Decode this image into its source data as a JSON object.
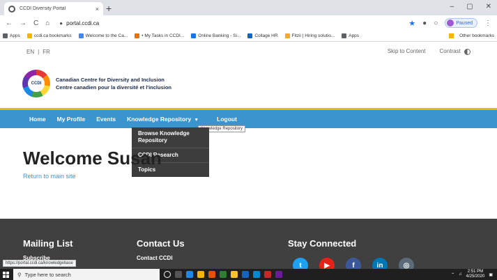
{
  "browser": {
    "tab_title": "CCDI Diversity Portal",
    "tab_close": "×",
    "new_tab": "+",
    "window_controls": [
      "–",
      "▢",
      "✕"
    ],
    "nav_buttons": [
      "←",
      "→",
      "C",
      "⌂"
    ],
    "url": "portal.ccdi.ca",
    "profile_status": "Paused",
    "menu_icon": "⋮",
    "bookmarks": [
      {
        "label": "Apps",
        "color": "#5f6368"
      },
      {
        "label": "ccdi.ca bookmarks",
        "color": "#f4b400"
      },
      {
        "label": "Welcome to the Ca...",
        "color": "#4285f4"
      },
      {
        "label": "• My Tasks in CCDI...",
        "color": "#e8710a"
      },
      {
        "label": "Online Banking - Si...",
        "color": "#1a73e8"
      },
      {
        "label": "Collage HR",
        "color": "#1565c0"
      },
      {
        "label": "Fitzii | Hiring solutio...",
        "color": "#f9a825"
      },
      {
        "label": "Apps",
        "color": "#5f6368"
      }
    ],
    "other_bookmarks": "Other bookmarks"
  },
  "util": {
    "lang_en": "EN",
    "lang_sep": "|",
    "lang_fr": "FR",
    "skip": "Skip to Content",
    "contrast": "Contrast"
  },
  "brand": {
    "logo_text": "CCDI",
    "name_en": "Canadian Centre for Diversity and Inclusion",
    "name_fr": "Centre canadien pour la diversité et l'inclusion"
  },
  "nav": {
    "home": "Home",
    "profile": "My Profile",
    "events": "Events",
    "knowledge": "Knowledge Repository",
    "logout": "Logout"
  },
  "tooltip": "Knowledge Repository",
  "dropdown": {
    "browse": "Browse Knowledge Repository",
    "research": "CCDI Research",
    "topics": "Topics"
  },
  "main": {
    "welcome": "Welcome Susan",
    "return_link": "Return to main site"
  },
  "footer": {
    "mailing": "Mailing List",
    "subscribe": "Subscribe",
    "contact": "Contact Us",
    "contact_ccdi": "Contact CCDI",
    "stay": "Stay Connected",
    "social": [
      {
        "icon": "twitter-icon",
        "glyph": "t",
        "color": "#1da1f2"
      },
      {
        "icon": "youtube-icon",
        "glyph": "▶",
        "color": "#e62117"
      },
      {
        "icon": "facebook-icon",
        "glyph": "f",
        "color": "#3b5998"
      },
      {
        "icon": "linkedin-icon",
        "glyph": "in",
        "color": "#0077b5"
      },
      {
        "icon": "instagram-icon",
        "glyph": "◎",
        "color": "#5b6b7a"
      }
    ]
  },
  "status_url": "https://portal.ccdi.ca/knowledgebase",
  "taskbar": {
    "search_placeholder": "Type here to search",
    "time": "2:51 PM",
    "date": "4/25/2020"
  }
}
